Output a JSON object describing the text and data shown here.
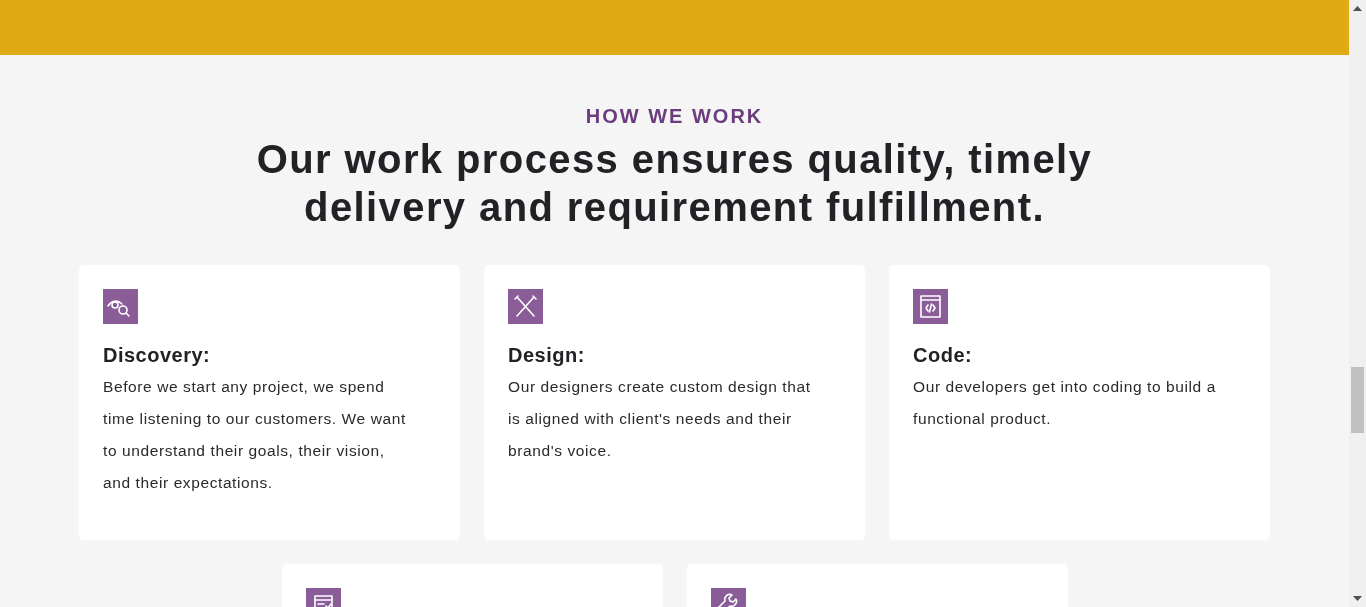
{
  "section": {
    "eyebrow": "HOW WE WORK",
    "heading": "Our work process ensures quality, timely delivery and requirement fulfillment."
  },
  "cards": [
    {
      "kind": "full",
      "title": "Discovery:",
      "text": "Before we start any project, we spend time listening to our customers. We want to understand their goals, their vision, and their expectations."
    },
    {
      "kind": "full",
      "title": "Design:",
      "text": "Our designers create custom design that is aligned with client's needs and their brand's voice."
    },
    {
      "kind": "full",
      "title": "Code:",
      "text": "Our developers get into coding to build a functional product."
    },
    {
      "kind": "cut_off"
    },
    {
      "kind": "cut_off"
    }
  ]
}
